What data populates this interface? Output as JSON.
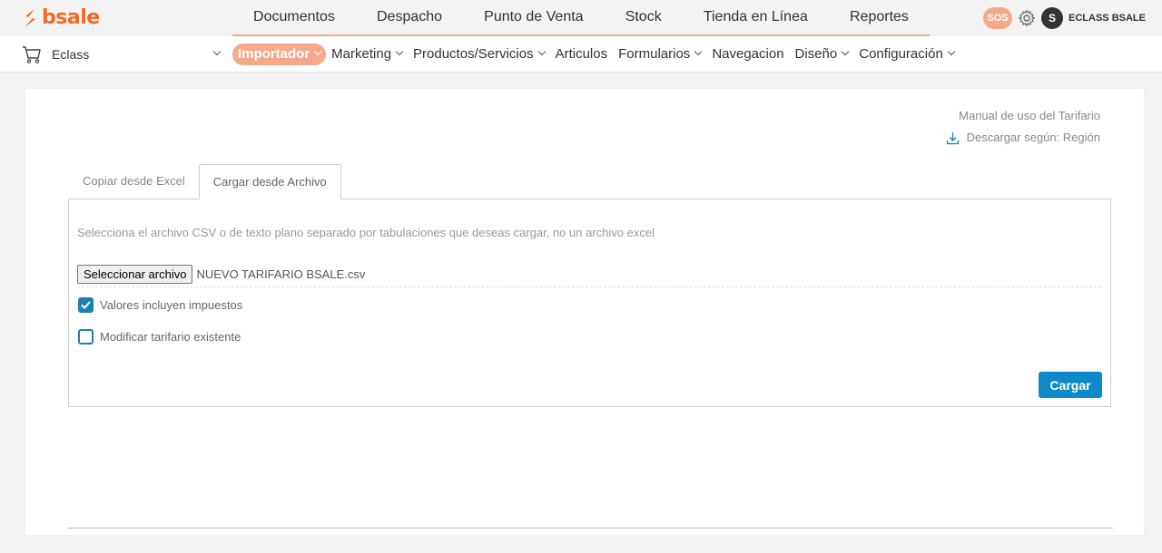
{
  "brand": {
    "name": "bsale",
    "accent": "#f26b24"
  },
  "main_nav": [
    "Documentos",
    "Despacho",
    "Punto de Venta",
    "Stock",
    "Tienda en Línea",
    "Reportes"
  ],
  "top_right": {
    "sos": "SOS",
    "avatar_letter": "S",
    "user": "ECLASS BSALE"
  },
  "store": {
    "name": "Eclass"
  },
  "sub_nav": {
    "importador": "Importador",
    "marketing": "Marketing",
    "productos": "Productos/Servicios",
    "articulos": "Articulos",
    "formularios": "Formularios",
    "navegacion": "Navegacion",
    "diseno": "Diseño",
    "configuracion": "Configuración"
  },
  "links": {
    "manual": "Manual de uso del Tarifario",
    "download": "Descargar según: Región"
  },
  "tabs": {
    "excel": "Copiar desde Excel",
    "archivo": "Cargar desde Archivo"
  },
  "form": {
    "help": "Selecciona el archivo CSV o de texto plano separado por tabulaciones que deseas cargar, no un archivo excel",
    "file_button": "Seleccionar archivo",
    "file_name": "NUEVO TARIFARIO BSALE.csv",
    "taxes_label": "Valores incluyen impuestos",
    "taxes_checked": true,
    "modify_label": "Modificar tarifario existente",
    "modify_checked": false,
    "submit": "Cargar"
  }
}
